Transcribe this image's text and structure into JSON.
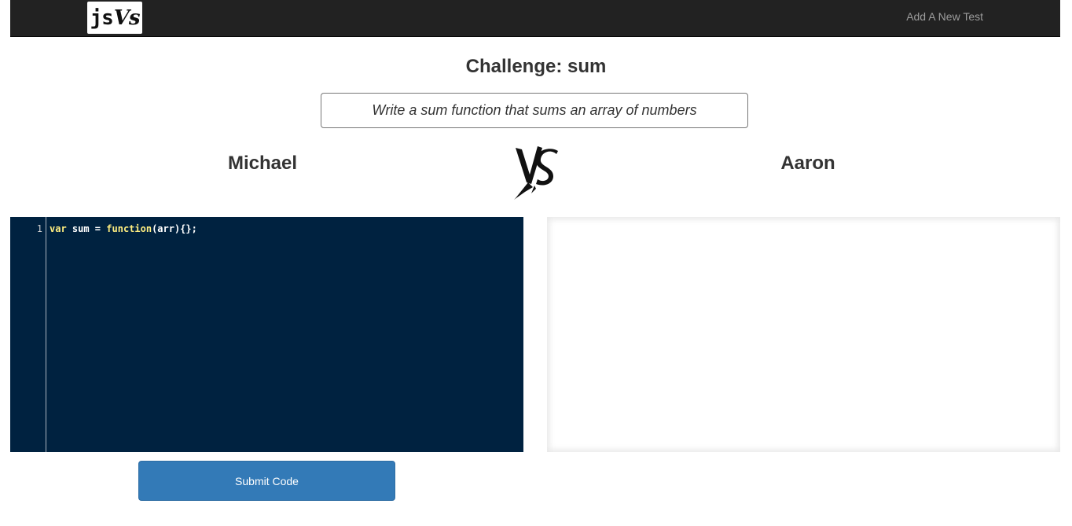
{
  "navbar": {
    "logo_text_js": "js",
    "logo_text_vs": "Vs",
    "add_test_link": "Add A New Test"
  },
  "challenge": {
    "title": "Challenge: sum",
    "description": "Write a sum function that sums an array of numbers"
  },
  "players": {
    "left_name": "Michael",
    "right_name": "Aaron",
    "vs_icon": "vs-icon"
  },
  "editor": {
    "line_numbers": [
      "1"
    ],
    "code": {
      "kw_var": "var",
      "text_1": " sum = ",
      "kw_function": "function",
      "text_2": "(arr){};"
    },
    "colors": {
      "background": "#002240",
      "keyword": "#ffee80",
      "text": "#ffffff"
    }
  },
  "actions": {
    "submit_label": "Submit Code",
    "submit_color": "#337ab7"
  }
}
